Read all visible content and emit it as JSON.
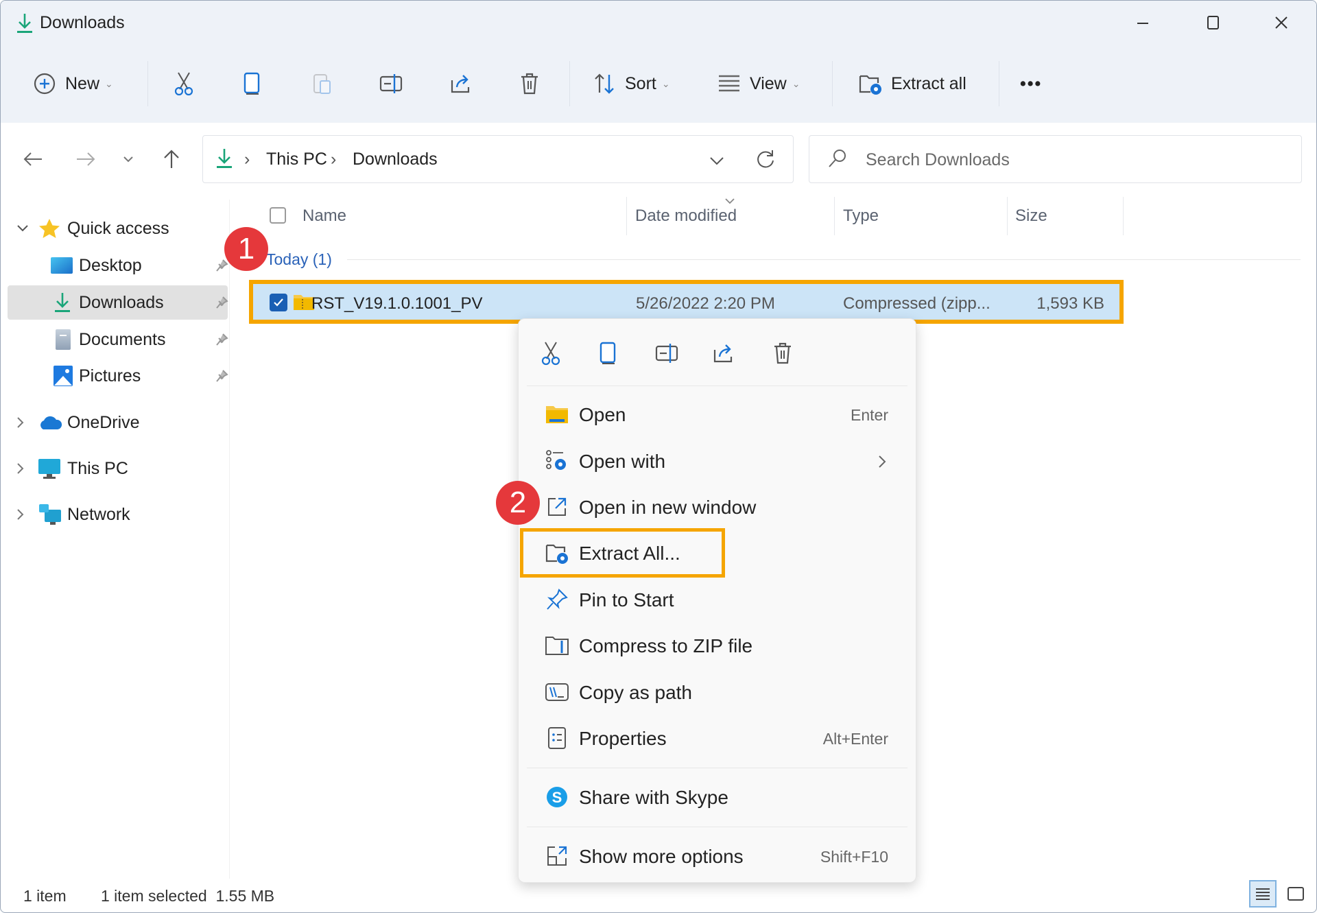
{
  "window": {
    "title": "Downloads",
    "controls": {
      "minimize": "minimize",
      "maximize": "maximize",
      "close": "close"
    }
  },
  "toolbar": {
    "new_label": "New",
    "sort_label": "Sort",
    "view_label": "View",
    "extract_all_label": "Extract all",
    "more_label": "•••",
    "icons": [
      "cut-icon",
      "copy-icon",
      "paste-icon",
      "rename-icon",
      "share-icon",
      "delete-icon"
    ]
  },
  "navigation": {
    "breadcrumb": [
      "This PC",
      "Downloads"
    ],
    "breadcrumb_separator": "›",
    "search_placeholder": "Search Downloads"
  },
  "sidebar": {
    "items": [
      {
        "label": "Quick access",
        "icon": "star-icon",
        "expanded": true,
        "pinned": false
      },
      {
        "label": "Desktop",
        "icon": "desktop-folder-icon",
        "pinned": true
      },
      {
        "label": "Downloads",
        "icon": "download-icon",
        "pinned": true,
        "selected": true
      },
      {
        "label": "Documents",
        "icon": "documents-icon",
        "pinned": true
      },
      {
        "label": "Pictures",
        "icon": "pictures-icon",
        "pinned": true
      },
      {
        "label": "OneDrive",
        "icon": "cloud-icon",
        "expanded": false
      },
      {
        "label": "This PC",
        "icon": "monitor-icon",
        "expanded": false
      },
      {
        "label": "Network",
        "icon": "network-icon",
        "expanded": false
      }
    ]
  },
  "file_list": {
    "columns": [
      "Name",
      "Date modified",
      "Type",
      "Size"
    ],
    "group_label": "Today (1)",
    "rows": [
      {
        "name": "RST_V19.1.0.1001_PV",
        "date_modified": "5/26/2022 2:20 PM",
        "type": "Compressed (zipp...",
        "size": "1,593 KB",
        "selected": true
      }
    ]
  },
  "context_menu": {
    "quick_actions": [
      "cut-icon",
      "copy-icon",
      "rename-icon",
      "share-icon",
      "delete-icon"
    ],
    "items": [
      {
        "label": "Open",
        "shortcut": "Enter",
        "icon": "folder-open-icon"
      },
      {
        "label": "Open with",
        "shortcut": "",
        "icon": "open-with-icon",
        "submenu": true
      },
      {
        "label": "Open in new window",
        "shortcut": "",
        "icon": "new-window-icon"
      },
      {
        "label": "Extract All...",
        "shortcut": "",
        "icon": "extract-icon",
        "highlighted": true
      },
      {
        "label": "Pin to Start",
        "shortcut": "",
        "icon": "pin-icon"
      },
      {
        "label": "Compress to ZIP file",
        "shortcut": "",
        "icon": "zip-icon"
      },
      {
        "label": "Copy as path",
        "shortcut": "",
        "icon": "copy-path-icon"
      },
      {
        "label": "Properties",
        "shortcut": "Alt+Enter",
        "icon": "properties-icon"
      },
      {
        "label": "Share with Skype",
        "shortcut": "",
        "icon": "skype-icon"
      },
      {
        "label": "Show more options",
        "shortcut": "Shift+F10",
        "icon": "more-options-icon"
      }
    ]
  },
  "annotations": {
    "step1": "1",
    "step2": "2"
  },
  "status_bar": {
    "item_count": "1 item",
    "selection": "1 item selected  1.55 MB"
  },
  "colors": {
    "accent_blue": "#1a73d4",
    "download_green": "#1aa579",
    "highlight_orange": "#f5a500",
    "badge_red": "#e5383b",
    "selection_bg": "#cce4f7"
  }
}
